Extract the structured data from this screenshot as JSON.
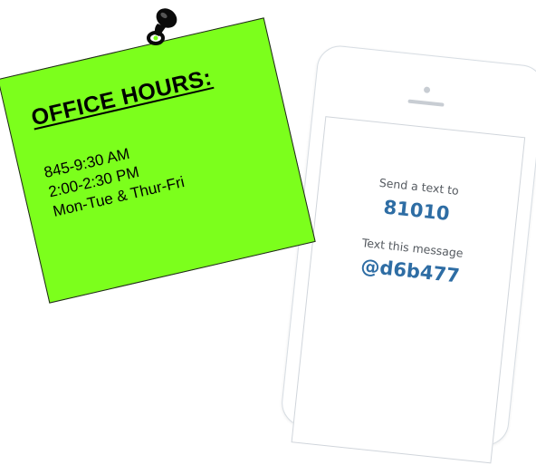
{
  "note": {
    "title": "OFFICE HOURS:",
    "lines": [
      "845-9:30 AM",
      "2:00-2:30 PM",
      "Mon-Tue & Thur-Fri"
    ]
  },
  "phone": {
    "send_label": "Send a text to",
    "number": "81010",
    "message_label": "Text this message",
    "message_code": "@d6b477"
  },
  "colors": {
    "note_background": "#7cff1c",
    "phone_value_text": "#2e6da4"
  },
  "icons": {
    "pin": "push-pin-icon"
  }
}
